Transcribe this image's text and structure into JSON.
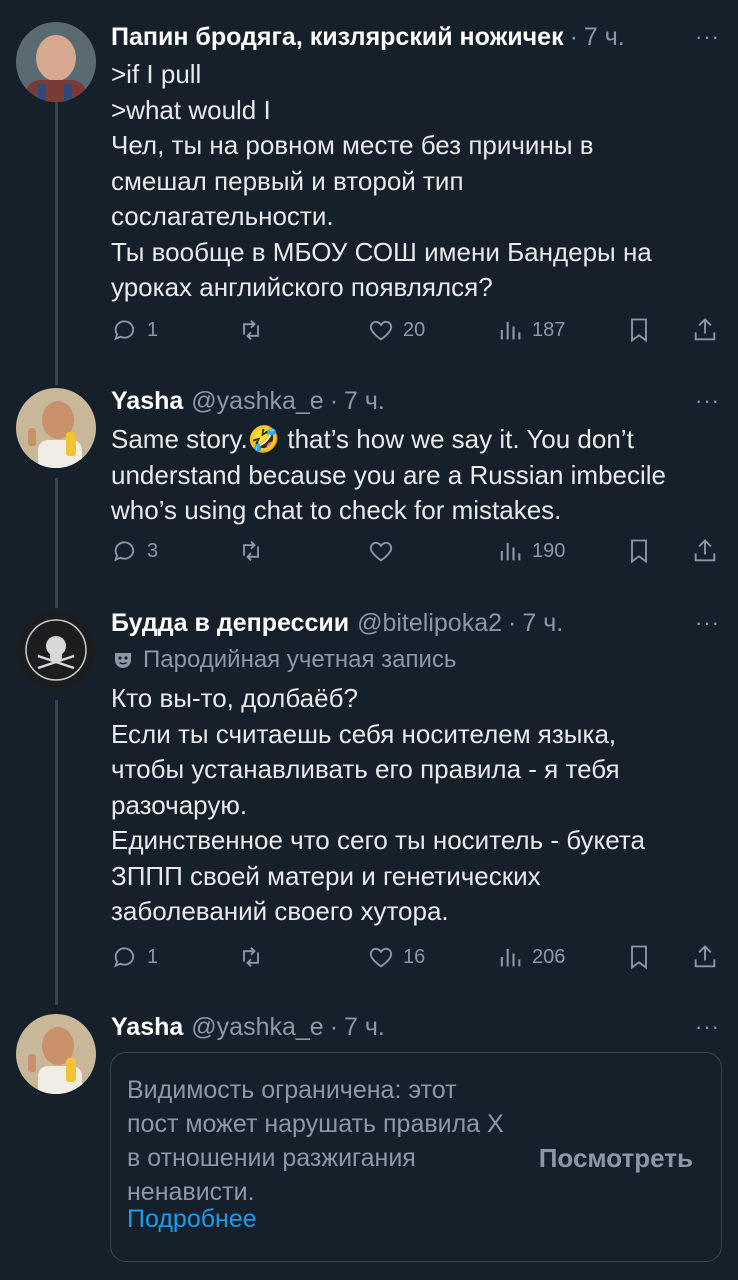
{
  "tweets": [
    {
      "name": "Папин бродяга, кизлярский ножичек",
      "handle": "",
      "time": "7 ч.",
      "more": "···",
      "lines": [
        ">if I pull",
        ">what would I",
        "Чел, ты на ровном месте без причины в",
        "смешал первый и второй тип",
        "сослагательности.",
        "Ты вообще в МБОУ СОШ имени Бандеры на",
        "уроках английского появлялся?"
      ],
      "replies": "1",
      "reposts": "",
      "likes": "20",
      "views": "187"
    },
    {
      "name": "Yasha",
      "handle": "@yashka_e",
      "time": "7 ч.",
      "more": "···",
      "lines": [
        "Same story.🤣 that’s how we say it. You don’t",
        "understand because you are a Russian imbecile",
        "who’s using chat to check for mistakes."
      ],
      "replies": "3",
      "reposts": "",
      "likes": "",
      "views": "190"
    },
    {
      "name": "Будда в депрессии",
      "handle": "@bitelipoka2",
      "time": "7 ч.",
      "more": "···",
      "parody": "Пародийная учетная запись",
      "lines": [
        "Кто вы-то, долбаёб?",
        "Если ты считаешь себя носителем языка,",
        "чтобы устанавливать его правила - я тебя",
        "разочарую.",
        "Единственное что сего ты носитель - букета",
        "ЗППП своей матери и генетических",
        "заболеваний своего хутора."
      ],
      "replies": "1",
      "reposts": "",
      "likes": "16",
      "views": "206"
    },
    {
      "name": "Yasha",
      "handle": "@yashka_e",
      "time": "7 ч.",
      "more": "···",
      "restricted": {
        "message": "Видимость ограничена: этот пост может нарушать правила X в отношении разжигания ненависти.",
        "learn_more": "Подробнее",
        "view": "Посмотреть"
      }
    }
  ],
  "colors": {
    "background": "#15202b",
    "secondary_text": "#8b98a5",
    "link": "#1d9bf0",
    "thread_line": "#38444d"
  }
}
